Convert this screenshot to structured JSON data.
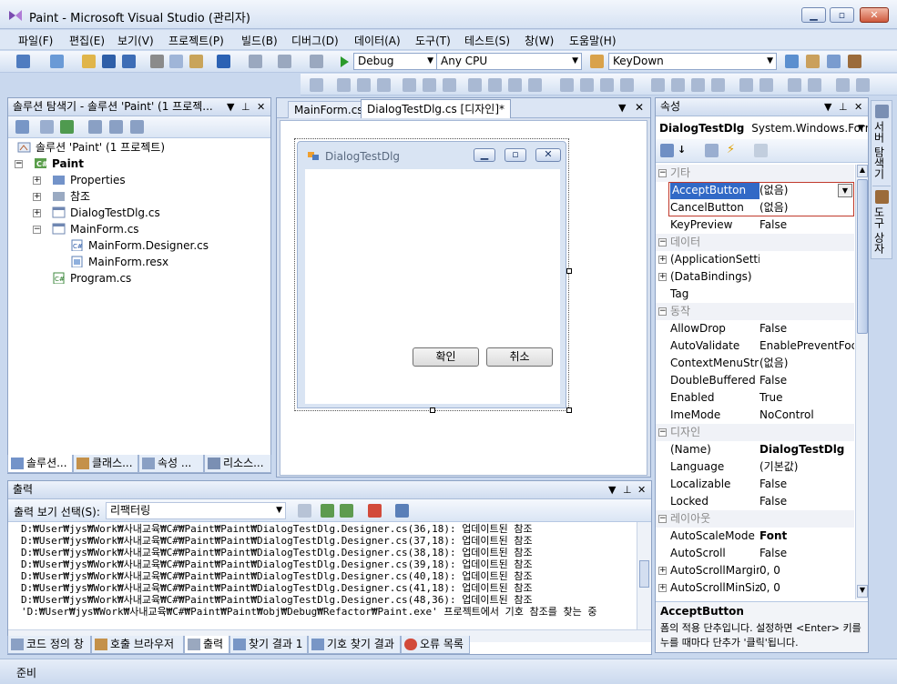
{
  "window": {
    "title": "Paint - Microsoft Visual Studio (관리자)"
  },
  "menu": [
    "파일(F)",
    "편집(E)",
    "보기(V)",
    "프로젝트(P)",
    "빌드(B)",
    "디버그(D)",
    "데이터(A)",
    "도구(T)",
    "테스트(S)",
    "창(W)",
    "도움말(H)"
  ],
  "toolbar": {
    "config": "Debug",
    "platform": "Any CPU",
    "event": "KeyDown"
  },
  "solution_explorer": {
    "title": "솔루션 탐색기 - 솔루션 'Paint' (1 프로젝...",
    "items": [
      "솔루션 'Paint' (1 프로젝트)",
      "Paint",
      "Properties",
      "참조",
      "DialogTestDlg.cs",
      "MainForm.cs",
      "MainForm.Designer.cs",
      "MainForm.resx",
      "Program.cs"
    ],
    "tabs": [
      "솔루션...",
      "클래스...",
      "속성 ...",
      "리소스..."
    ]
  },
  "editor": {
    "tabs": [
      "MainForm.cs",
      "DialogTestDlg.cs [디자인]*"
    ],
    "dialog_title": "DialogTestDlg",
    "ok_button": "확인",
    "cancel_button": "취소"
  },
  "properties": {
    "title": "속성",
    "object_name": "DialogTestDlg",
    "object_type": "System.Windows.Forms",
    "rows": [
      {
        "cat": true,
        "name": "기타"
      },
      {
        "name": "AcceptButton",
        "value": "(없음)",
        "selected": true
      },
      {
        "name": "CancelButton",
        "value": "(없음)"
      },
      {
        "name": "KeyPreview",
        "value": "False"
      },
      {
        "cat": true,
        "name": "데이터"
      },
      {
        "name": "(ApplicationSettir",
        "value": "",
        "exp": true
      },
      {
        "name": "(DataBindings)",
        "value": "",
        "exp": true
      },
      {
        "name": "Tag",
        "value": ""
      },
      {
        "cat": true,
        "name": "동작"
      },
      {
        "name": "AllowDrop",
        "value": "False"
      },
      {
        "name": "AutoValidate",
        "value": "EnablePreventFocu"
      },
      {
        "name": "ContextMenuStrij",
        "value": "(없음)"
      },
      {
        "name": "DoubleBuffered",
        "value": "False"
      },
      {
        "name": "Enabled",
        "value": "True"
      },
      {
        "name": "ImeMode",
        "value": "NoControl"
      },
      {
        "cat": true,
        "name": "디자인"
      },
      {
        "name": "(Name)",
        "value": "DialogTestDlg",
        "bold": true
      },
      {
        "name": "Language",
        "value": "(기본값)"
      },
      {
        "name": "Localizable",
        "value": "False"
      },
      {
        "name": "Locked",
        "value": "False"
      },
      {
        "cat": true,
        "name": "레이아웃"
      },
      {
        "name": "AutoScaleMode",
        "value": "Font",
        "bold": true
      },
      {
        "name": "AutoScroll",
        "value": "False"
      },
      {
        "name": "AutoScrollMargin",
        "value": "0, 0",
        "exp": true
      },
      {
        "name": "AutoScrollMinSiz",
        "value": "0, 0",
        "exp": true
      }
    ],
    "desc_title": "AcceptButton",
    "desc_text": "폼의 적용 단추입니다. 설정하면 <Enter> 키를 누를 때마다 단추가 '클릭'됩니다."
  },
  "side_tabs": [
    "서버 탐색기",
    "도구 상자"
  ],
  "output": {
    "title": "출력",
    "select_label": "출력 보기 선택(S):",
    "select_value": "리팩터링",
    "lines": [
      "D:₩User₩jys₩Work₩사내교육₩C#₩Paint₩Paint₩DialogTestDlg.Designer.cs(36,18): 업데이트된 참조",
      "D:₩User₩jys₩Work₩사내교육₩C#₩Paint₩Paint₩DialogTestDlg.Designer.cs(37,18): 업데이트된 참조",
      "D:₩User₩jys₩Work₩사내교육₩C#₩Paint₩Paint₩DialogTestDlg.Designer.cs(38,18): 업데이트된 참조",
      "D:₩User₩jys₩Work₩사내교육₩C#₩Paint₩Paint₩DialogTestDlg.Designer.cs(39,18): 업데이트된 참조",
      "D:₩User₩jys₩Work₩사내교육₩C#₩Paint₩Paint₩DialogTestDlg.Designer.cs(40,18): 업데이트된 참조",
      "D:₩User₩jys₩Work₩사내교육₩C#₩Paint₩Paint₩DialogTestDlg.Designer.cs(41,18): 업데이트된 참조",
      "D:₩User₩jys₩Work₩사내교육₩C#₩Paint₩Paint₩DialogTestDlg.Designer.cs(48,36): 업데이트된 참조",
      "'D:₩User₩jys₩Work₩사내교육₩C#₩Paint₩Paint₩obj₩Debug₩Refactor₩Paint.exe' 프로젝트에서 기호 참조를 찾는 중"
    ],
    "tabs": [
      "코드 정의 창",
      "호출 브라우저",
      "출력",
      "찾기 결과 1",
      "기호 찾기 결과",
      "오류 목록"
    ]
  },
  "status": "준비"
}
